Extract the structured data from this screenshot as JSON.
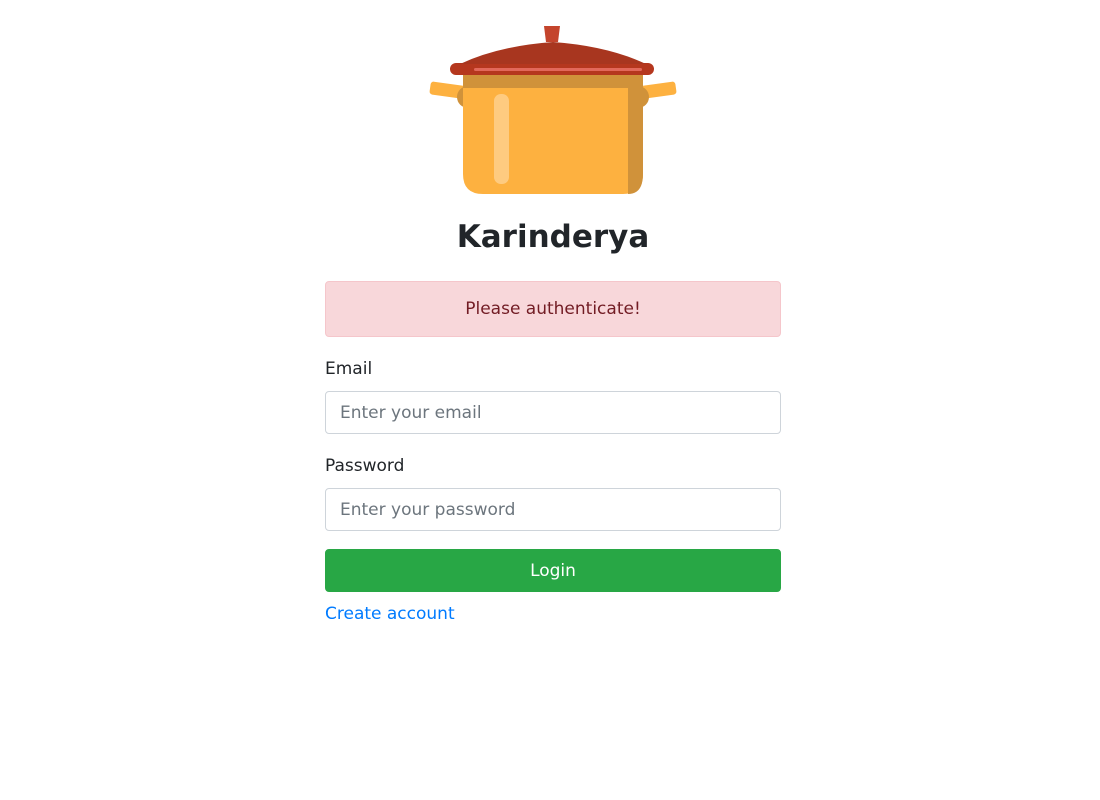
{
  "app": {
    "title": "Karinderya"
  },
  "alert": {
    "message": "Please authenticate!"
  },
  "form": {
    "email_label": "Email",
    "email_placeholder": "Enter your email",
    "email_value": "",
    "password_label": "Password",
    "password_placeholder": "Enter your password",
    "password_value": "",
    "login_label": "Login",
    "create_account_label": "Create account"
  },
  "icons": {
    "logo": "cooking-pot-icon"
  },
  "colors": {
    "alert_bg": "#f8d7da",
    "alert_text": "#721c24",
    "login_button": "#28a745",
    "link": "#007bff",
    "pot_body": "#fdb140",
    "pot_lid": "#b5371e"
  }
}
